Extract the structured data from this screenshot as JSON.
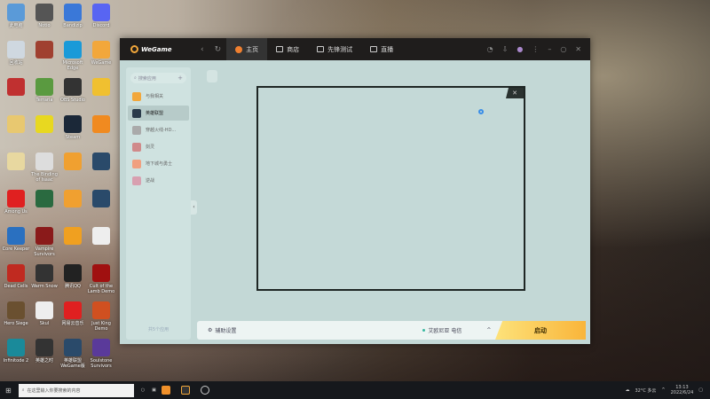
{
  "desktop": {
    "icons": [
      {
        "label": "此电脑",
        "color": "#5a9ad8"
      },
      {
        "label": "Notio",
        "color": "#555"
      },
      {
        "label": "Bandizip",
        "color": "#3a78d8"
      },
      {
        "label": "Discord",
        "color": "#5865f2"
      },
      {
        "label": "回收站",
        "color": "#cfd8e0"
      },
      {
        "label": "",
        "color": "#a04030"
      },
      {
        "label": "Microsoft Edge",
        "color": "#1a9ad8"
      },
      {
        "label": "WeGame",
        "color": "#f2a73b"
      },
      {
        "label": "",
        "color": "#c03030"
      },
      {
        "label": "Terraria",
        "color": "#5a9a40"
      },
      {
        "label": "OBS Studio",
        "color": "#333"
      },
      {
        "label": "",
        "color": "#f0c030"
      },
      {
        "label": "",
        "color": "#e8c870"
      },
      {
        "label": "",
        "color": "#e8d820"
      },
      {
        "label": "Steam",
        "color": "#1b2838"
      },
      {
        "label": "",
        "color": "#f08a20"
      },
      {
        "label": "",
        "color": "#e8d8a0"
      },
      {
        "label": "The Binding of Isaac",
        "color": "#ddd"
      },
      {
        "label": "",
        "color": "#f0a030"
      },
      {
        "label": "",
        "color": "#2a4a6a"
      },
      {
        "label": "Among Us",
        "color": "#e02020"
      },
      {
        "label": "",
        "color": "#2a6a40"
      },
      {
        "label": "",
        "color": "#f0a030"
      },
      {
        "label": "",
        "color": "#2a4a6a"
      },
      {
        "label": "Core Keeper",
        "color": "#2a70c0"
      },
      {
        "label": "Vampire Survivors",
        "color": "#8a1a1a"
      },
      {
        "label": "",
        "color": "#f0a020"
      },
      {
        "label": "",
        "color": "#eee"
      },
      {
        "label": "Dead Cells",
        "color": "#c02a20"
      },
      {
        "label": "Warm Snow",
        "color": "#333"
      },
      {
        "label": "腾讯QQ",
        "color": "#222"
      },
      {
        "label": "Cult of the Lamb Demo",
        "color": "#a01010"
      },
      {
        "label": "Hero Siege",
        "color": "#6a5030"
      },
      {
        "label": "Skul",
        "color": "#eee"
      },
      {
        "label": "网易云音乐",
        "color": "#e02020"
      },
      {
        "label": "Just King Demo",
        "color": "#d05020"
      },
      {
        "label": "Infinitode 2",
        "color": "#1a8a9a"
      },
      {
        "label": "英雄之时",
        "color": "#333"
      },
      {
        "label": "英雄联盟WeGame版",
        "color": "#2a4a6a"
      },
      {
        "label": "Soulstone Survivors",
        "color": "#5a3a9a"
      }
    ]
  },
  "wegame": {
    "brand": "WeGame",
    "tabs": [
      {
        "label": "主页",
        "active": true
      },
      {
        "label": "商店"
      },
      {
        "label": "先锋测试"
      },
      {
        "label": "直播"
      }
    ],
    "search_placeholder": "搜索应用",
    "sidebar": [
      {
        "label": "与我相关",
        "color": "#f2a73b"
      },
      {
        "label": "英雄联盟",
        "color": "#2a3a4a",
        "active": true
      },
      {
        "label": "穿越火线-HD...",
        "color": "#aaa"
      },
      {
        "label": "剑灵",
        "color": "#d08a8a"
      },
      {
        "label": "地下城与勇士",
        "color": "#f0a080"
      },
      {
        "label": "逆战",
        "color": "#d8a0b0"
      }
    ],
    "app_count": "共5个应用",
    "assist_settings": "辅助设置",
    "server": "艾欧尼亚 电信",
    "launch": "启动",
    "accent": "#f9b53a"
  },
  "taskbar": {
    "search_placeholder": "在这里输入你要搜索的内容",
    "weather": "32°C 多云",
    "time": "13:13",
    "date": "2022/6/24"
  }
}
